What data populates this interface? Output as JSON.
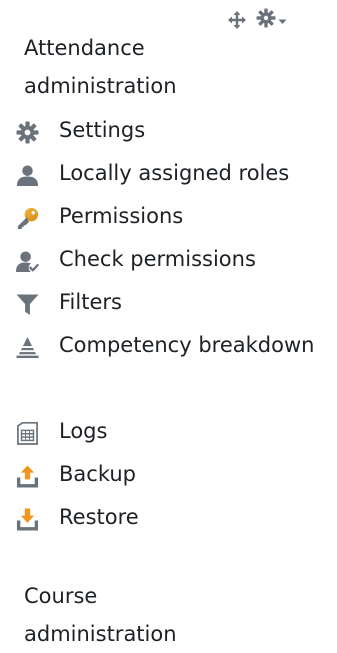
{
  "block": {
    "title": "Attendance administration",
    "items": [
      {
        "label": "Settings",
        "icon": "gear-icon"
      },
      {
        "label": "Locally assigned roles",
        "icon": "user-icon"
      },
      {
        "label": "Permissions",
        "icon": "key-icon"
      },
      {
        "label": "Check permissions",
        "icon": "user-check-icon"
      },
      {
        "label": "Filters",
        "icon": "filter-icon"
      },
      {
        "label": "Competency breakdown",
        "icon": "competency-icon"
      },
      {
        "label": "Logs",
        "icon": "logs-icon"
      },
      {
        "label": "Backup",
        "icon": "backup-icon"
      },
      {
        "label": "Restore",
        "icon": "restore-icon"
      }
    ],
    "next_section_title": "Course administration"
  },
  "colors": {
    "text": "#1d2125",
    "icon": "#6a737b"
  }
}
